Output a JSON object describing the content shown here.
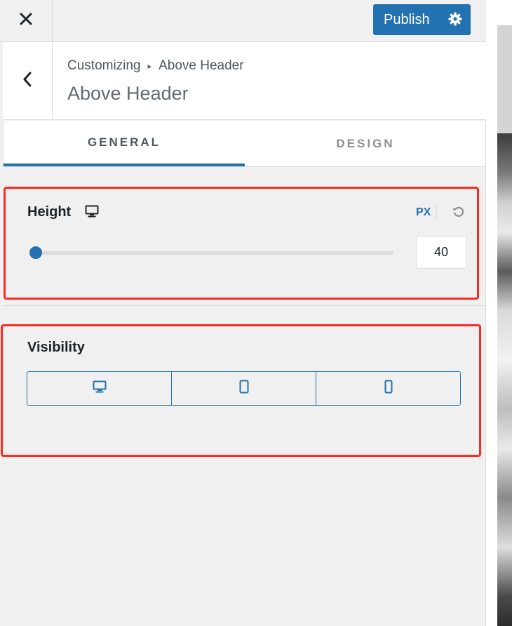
{
  "topbar": {
    "close_icon": "close-icon",
    "publish_label": "Publish",
    "gear_icon": "gear-icon"
  },
  "header": {
    "back_icon": "chevron-left-icon",
    "breadcrumb_parent": "Customizing",
    "breadcrumb_separator": "▸",
    "breadcrumb_current": "Above Header",
    "title": "Above Header"
  },
  "tabs": [
    {
      "label": "GENERAL",
      "active": true
    },
    {
      "label": "DESIGN",
      "active": false
    }
  ],
  "height_control": {
    "title": "Height",
    "device_icon": "desktop-icon",
    "unit": "PX",
    "reset_icon": "reset-icon",
    "value": "40",
    "slider_fraction": 0.0
  },
  "visibility_control": {
    "title": "Visibility",
    "options": [
      {
        "icon": "desktop-icon"
      },
      {
        "icon": "tablet-icon"
      },
      {
        "icon": "mobile-icon"
      }
    ]
  },
  "colors": {
    "accent": "#2271b1",
    "highlight": "#ff2a1f",
    "panel_bg": "#f0f0f1"
  }
}
